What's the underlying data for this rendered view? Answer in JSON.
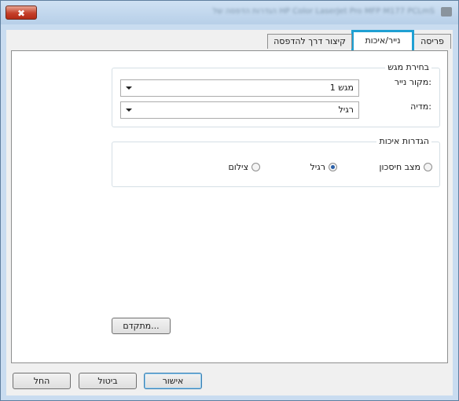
{
  "window": {
    "title": "הגדרות הדפסה של HP Color LaserJet Pro MFP M177 PCLmS",
    "close_symbol": "✖"
  },
  "tabs": [
    {
      "label": "פריסה",
      "selected": false
    },
    {
      "label": "נייר/איכות",
      "selected": true
    },
    {
      "label": "קיצור דרך להדפסה",
      "selected": false
    }
  ],
  "tray": {
    "title": "בחירת מגש",
    "source_label": "מקור נייר:",
    "source_value": "מגש 1",
    "media_label": "מדיה:",
    "media_value": "רגיל"
  },
  "quality": {
    "title": "הגדרות איכות",
    "options": [
      {
        "label": "מצב חיסכון",
        "checked": false
      },
      {
        "label": "רגיל",
        "checked": true
      },
      {
        "label": "צילום",
        "checked": false
      }
    ]
  },
  "advanced_button": "מתקדם...",
  "buttons": {
    "ok": "אישור",
    "cancel": "ביטול",
    "apply": "החל"
  }
}
